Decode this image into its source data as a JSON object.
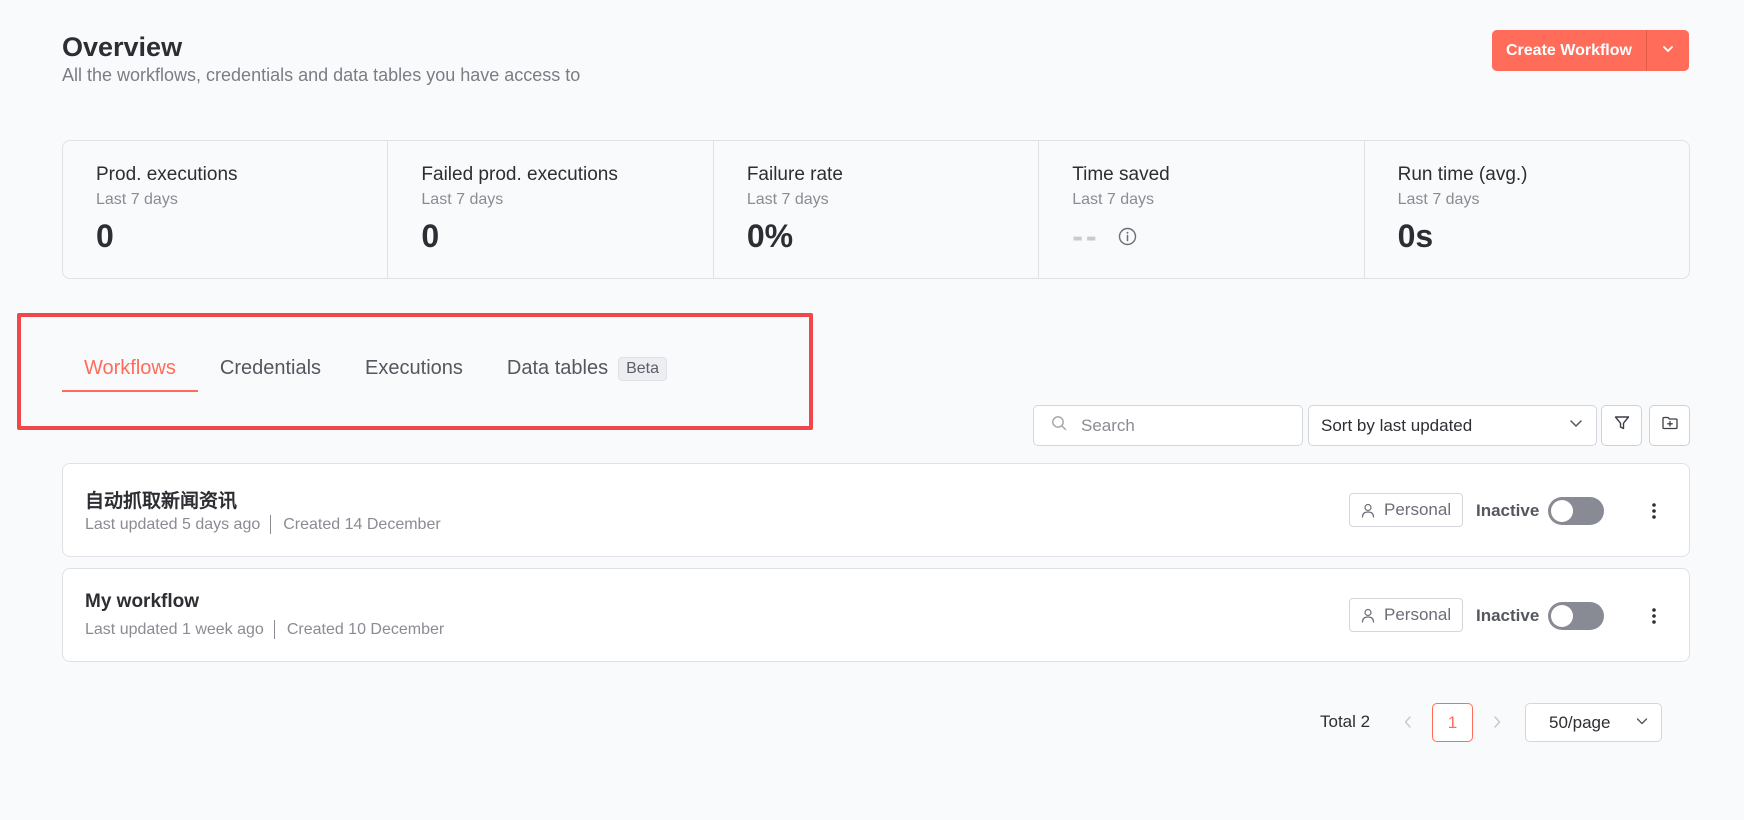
{
  "header": {
    "title": "Overview",
    "subtitle": "All the workflows, credentials and data tables you have access to",
    "create_label": "Create Workflow",
    "accent_color": "#ff6d5a"
  },
  "stats": [
    {
      "label": "Prod. executions",
      "period": "Last 7 days",
      "value": "0"
    },
    {
      "label": "Failed prod. executions",
      "period": "Last 7 days",
      "value": "0"
    },
    {
      "label": "Failure rate",
      "period": "Last 7 days",
      "value": "0%"
    },
    {
      "label": "Time saved",
      "period": "Last 7 days",
      "value": "--",
      "icon": "info-icon"
    },
    {
      "label": "Run time (avg.)",
      "period": "Last 7 days",
      "value": "0s"
    }
  ],
  "tabs": [
    {
      "label": "Workflows",
      "active": true
    },
    {
      "label": "Credentials"
    },
    {
      "label": "Executions"
    },
    {
      "label": "Data tables",
      "badge": "Beta"
    }
  ],
  "highlight_color": "#f0474a",
  "toolbar": {
    "search_placeholder": "Search",
    "sort_value": "Sort by last updated",
    "filter_icon": "filter-icon",
    "new_folder_icon": "folder-plus-icon"
  },
  "workflows": [
    {
      "name": "自动抓取新闻资讯",
      "updated": "Last updated 5 days ago",
      "created": "Created 14 December",
      "owner": "Personal",
      "status": "Inactive",
      "active": false
    },
    {
      "name": "My workflow",
      "updated": "Last updated 1 week ago",
      "created": "Created 10 December",
      "owner": "Personal",
      "status": "Inactive",
      "active": false
    }
  ],
  "pagination": {
    "total": "Total 2",
    "current_page": "1",
    "page_size": "50/page"
  }
}
